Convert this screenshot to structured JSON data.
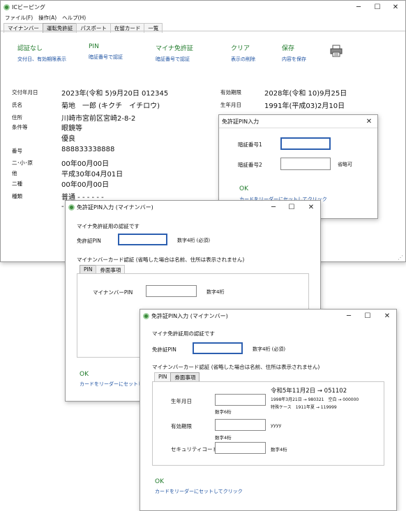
{
  "main": {
    "title": "ICビーピング",
    "controls": {
      "minimize": "─",
      "maximize": "☐",
      "close": "✕"
    },
    "menu": [
      "ファイル(F)",
      "操作(A)",
      "ヘルプ(H)"
    ],
    "tabs": [
      "マイナンバー",
      "運転免許証",
      "パスポート",
      "在留カード",
      "一覧"
    ],
    "toolbar": [
      {
        "title": "認証なし",
        "sub": "交付日、有効期限表示"
      },
      {
        "title": "PIN",
        "sub": "暗証番号で認証"
      },
      {
        "title": "マイナ免許証",
        "sub": "暗証番号で認証"
      },
      {
        "title": "クリア",
        "sub": "表示の削除"
      },
      {
        "title": "保存",
        "sub": "内容を保存"
      }
    ],
    "printer_icon": "printer-icon",
    "fields": {
      "issue_label": "交付年月日",
      "issue_value": "2023年(令和 5)9月20日 012345",
      "expiry_label": "有効期限",
      "expiry_value": "2028年(令和 10)9月25日",
      "name_label": "氏名",
      "name_value": "菊地　一郎 (キクチ　イチロウ)",
      "birth_label": "生年月日",
      "birth_value": "1991年(平成03)2月10日",
      "addr_label": "住所",
      "addr_value": "川崎市宮前区宮崎2-8-2",
      "cond_label": "条件等",
      "cond_value1": "眼鏡等",
      "cond_value2": "優良",
      "num_label": "番号",
      "num_value": "888833338888",
      "l1_label": "二･小･原",
      "l1_value": "00年00月00日",
      "l2_label": "他",
      "l2_value": "平成30年04月01日",
      "l3_label": "二種",
      "l3_value": "00年00月00日",
      "type_label": "種類",
      "type_value": "普通 - - - - - -",
      "type_value2": "-"
    }
  },
  "pinDialog": {
    "title": "免許証PIN入力",
    "close": "✕",
    "pin1_label": "暗証番号1",
    "pin2_label": "暗証番号2",
    "pin2_note": "省略可",
    "ok": "OK",
    "hint": "カードをリーダーにセットしてクリック"
  },
  "mynaDialog1": {
    "title": "免許証PIN入力 (マイナンバー)",
    "controls": {
      "minimize": "─",
      "maximize": "☐",
      "close": "✕"
    },
    "heading": "マイナ免許証用の認証です",
    "pin_label": "免許証PIN",
    "pin_note": "数字4桁 (必須)",
    "card_heading": "マイナンバーカード認証 (省略した場合は名前、住所は表示されません)",
    "tabs": [
      "PIN",
      "券面事項"
    ],
    "mpin_label": "マイナンバーPIN",
    "mpin_note": "数字4桁",
    "ok": "OK",
    "hint": "カードをリーダーにセットしてクリック"
  },
  "mynaDialog2": {
    "title": "免許証PIN入力 (マイナンバー)",
    "controls": {
      "minimize": "─",
      "maximize": "☐",
      "close": "✕"
    },
    "heading": "マイナ免許証用の認証です",
    "pin_label": "免許証PIN",
    "pin_note": "数字4桁 (必須)",
    "card_heading": "マイナンバーカード認証 (省略した場合は名前、住所は表示されません)",
    "tabs": [
      "PIN",
      "券面事項"
    ],
    "ex1": "令和5年11月2日 → 051102",
    "ex2": "1998年3月21日 → 980321　空白 → 000000",
    "ex3": "特殊ケース　1911年夏 → 119999",
    "birth_label": "生年月日",
    "birth_note": "数字6桁",
    "expiry_label": "有効期限",
    "expiry_note": "数字4桁",
    "expiry_hint": "yyyy",
    "sec_label": "セキュリティコード",
    "sec_note": "数字4桁",
    "ok": "OK",
    "hint": "カードをリーダーにセットしてクリック"
  }
}
